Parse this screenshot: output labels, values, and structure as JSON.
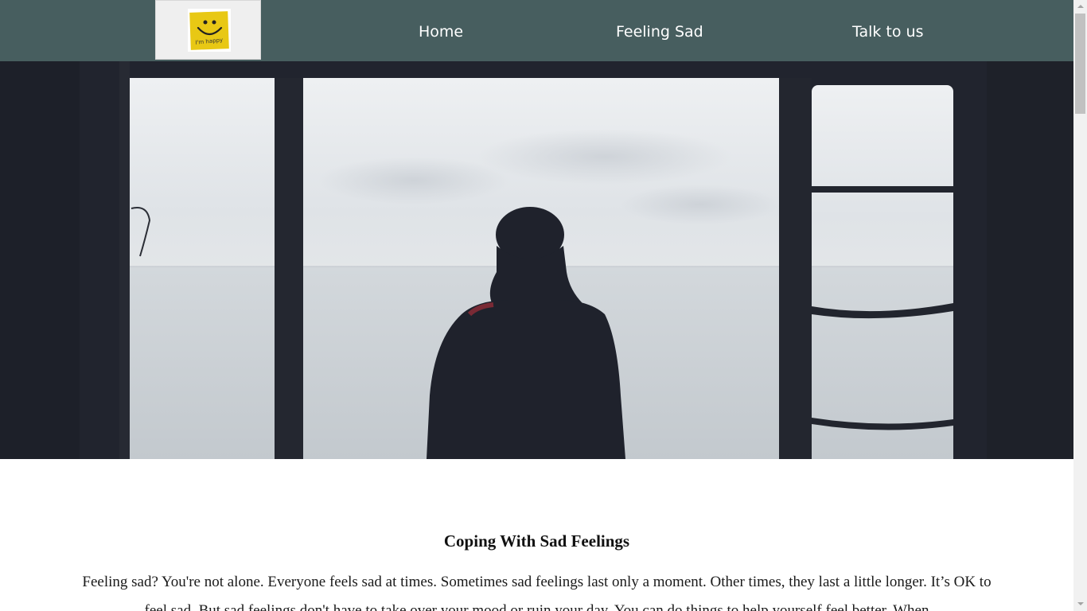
{
  "nav": {
    "logo_text": "I'm happy",
    "links": [
      {
        "label": "Home"
      },
      {
        "label": "Feeling Sad"
      },
      {
        "label": "Talk to us"
      }
    ]
  },
  "hero": {
    "image_subject": "silhouette-looking-at-sea"
  },
  "content": {
    "title": "Coping With Sad Feelings",
    "paragraph": "Feeling sad? You're not alone. Everyone feels sad at times. Sometimes sad feelings last only a moment. Other times, they last a little longer. It’s OK to feel sad. But sad feelings don't have to take over your mood or ruin your day. You can do things to help yourself feel better. When"
  },
  "colors": {
    "nav_background": "#475e5f",
    "logo_background": "#efefef",
    "sticky_note": "#e8c814",
    "hero_dark": "#21242e"
  }
}
